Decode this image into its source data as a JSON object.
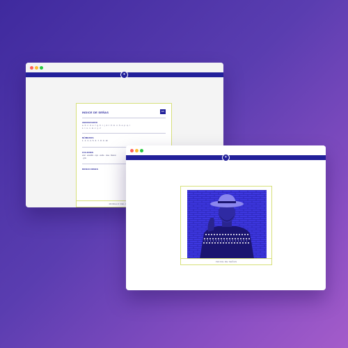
{
  "back_window": {
    "index_title": "INDICE DE SEÑAS",
    "badge": "ES",
    "sections": [
      {
        "title": "ABECEDARIO",
        "lines": [
          "a · b · c · d · e · f · g · h · i · j · k · l · ll · m · n · ñ · o · p · q · r",
          "s · t · u · v · w · x · y · z"
        ]
      },
      {
        "title": "NÚMEROS",
        "lines": [
          "1 · 2 · 3 · 4 · 5 · 6 · 7 · 8 · 9 · 10"
        ]
      },
      {
        "title": "COLORES",
        "lines": [
          "azul · amarillo · rojo · verde · rosa · blanco",
          "· gris"
        ]
      },
      {
        "title": "DIRECCIONES",
        "lines": [
          ""
        ]
      }
    ],
    "footer": "MODELO DEL PROYECTO"
  },
  "front_window": {
    "photo_caption": "INDICE DE SEÑAS"
  },
  "colors": {
    "nav": "#22209a",
    "photo_tint": "#3d37e0",
    "card_border": "#d7e07a"
  }
}
